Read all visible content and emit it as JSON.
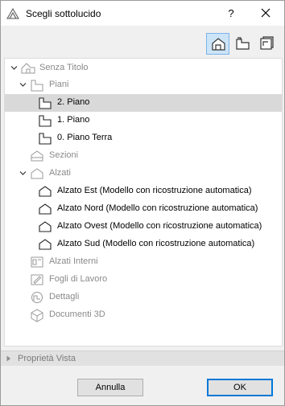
{
  "window": {
    "title": "Scegli sottolucido",
    "help_label": "?"
  },
  "toolbar": {
    "buttons": [
      {
        "icon": "view-map-icon",
        "active": true
      },
      {
        "icon": "layout-book-icon",
        "active": false
      },
      {
        "icon": "publisher-sets-icon",
        "active": false
      }
    ]
  },
  "tree": {
    "root": "Senza Titolo",
    "piani": "Piani",
    "piano_2": "2. Piano",
    "piano_1": "1. Piano",
    "piano_0": "0. Piano Terra",
    "sezioni": "Sezioni",
    "alzati": "Alzati",
    "alzato_est": "Alzato Est (Modello con ricostruzione automatica)",
    "alzato_nord": "Alzato Nord (Modello con ricostruzione automatica)",
    "alzato_ovest": "Alzato Ovest (Modello con ricostruzione automatica)",
    "alzato_sud": "Alzato Sud (Modello con ricostruzione automatica)",
    "alzati_interni": "Alzati Interni",
    "fogli_di_lavoro": "Fogli di Lavoro",
    "dettagli": "Dettagli",
    "documenti_3d": "Documenti 3D"
  },
  "properties": {
    "label": "Proprietà Vista"
  },
  "footer": {
    "cancel_label": "Annulla",
    "ok_label": "OK"
  },
  "colors": {
    "selected_row": "#d9d9d9",
    "active_tool": "#cce4f7",
    "default_button_border": "#0078d7"
  }
}
